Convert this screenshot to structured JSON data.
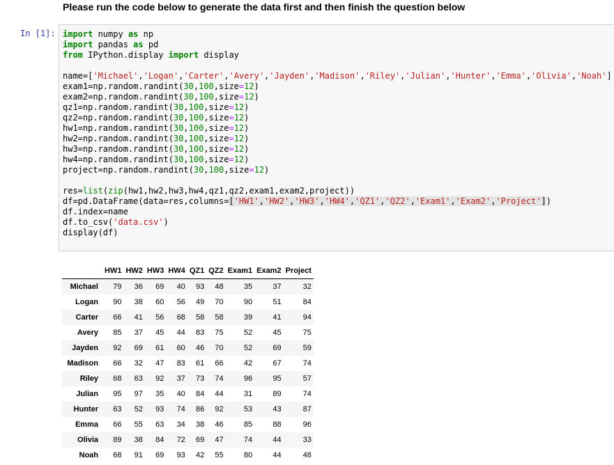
{
  "heading": "Please run the code below to generate the data first and then finish the question below",
  "prompt": "In [1]:",
  "code": {
    "l1_kw": "import",
    "l1_mod": " numpy ",
    "l1_as": "as",
    "l1_alias": " np",
    "l2_kw": "import",
    "l2_mod": " pandas ",
    "l2_as": "as",
    "l2_alias": " pd",
    "l3_from": "from",
    "l3_mod": " IPython.display ",
    "l3_kw": "import",
    "l3_name": " display",
    "names_prefix": "name=",
    "names": [
      "Michael",
      "Logan",
      "Carter",
      "Avery",
      "Jayden",
      "Madison",
      "Riley",
      "Julian",
      "Hunter",
      "Emma",
      "Olivia",
      "Noah"
    ],
    "assign_lines": [
      "exam1",
      "exam2",
      "qz1",
      "qz2",
      "hw1",
      "hw2",
      "hw3",
      "hw4",
      "project"
    ],
    "rand_call": "np.random.randint(",
    "rand_low": "30",
    "rand_high": "100",
    "rand_size_kw": "size",
    "rand_size": "12",
    "res_prefix": "res=",
    "res_list": "list",
    "res_zip": "zip",
    "res_args": "(hw1,hw2,hw3,hw4,qz1,qz2,exam1,exam2,project))",
    "df_prefix": "df=pd.DataFrame(data=res,columns=",
    "columns": [
      "HW1",
      "HW2",
      "HW3",
      "HW4",
      "QZ1",
      "QZ2",
      "Exam1",
      "Exam2",
      "Project"
    ],
    "index_line": "df.index=name",
    "csv_prefix": "df.to_csv(",
    "csv_file": "'data.csv'",
    "display_line": "display(df)"
  },
  "table": {
    "columns": [
      "HW1",
      "HW2",
      "HW3",
      "HW4",
      "QZ1",
      "QZ2",
      "Exam1",
      "Exam2",
      "Project"
    ],
    "rows": [
      {
        "name": "Michael",
        "values": [
          79,
          36,
          69,
          40,
          93,
          48,
          35,
          37,
          32
        ]
      },
      {
        "name": "Logan",
        "values": [
          90,
          38,
          60,
          56,
          49,
          70,
          90,
          51,
          84
        ]
      },
      {
        "name": "Carter",
        "values": [
          66,
          41,
          56,
          68,
          58,
          58,
          39,
          41,
          94
        ]
      },
      {
        "name": "Avery",
        "values": [
          85,
          37,
          45,
          44,
          83,
          75,
          52,
          45,
          75
        ]
      },
      {
        "name": "Jayden",
        "values": [
          92,
          69,
          61,
          60,
          46,
          70,
          52,
          69,
          59
        ]
      },
      {
        "name": "Madison",
        "values": [
          66,
          32,
          47,
          83,
          61,
          66,
          42,
          67,
          74
        ]
      },
      {
        "name": "Riley",
        "values": [
          68,
          63,
          92,
          37,
          73,
          74,
          96,
          95,
          57
        ]
      },
      {
        "name": "Julian",
        "values": [
          95,
          97,
          35,
          40,
          84,
          44,
          31,
          89,
          74
        ]
      },
      {
        "name": "Hunter",
        "values": [
          63,
          52,
          93,
          74,
          86,
          92,
          53,
          43,
          87
        ]
      },
      {
        "name": "Emma",
        "values": [
          66,
          55,
          63,
          34,
          38,
          46,
          85,
          88,
          96
        ]
      },
      {
        "name": "Olivia",
        "values": [
          89,
          38,
          84,
          72,
          69,
          47,
          74,
          44,
          33
        ]
      },
      {
        "name": "Noah",
        "values": [
          68,
          91,
          69,
          93,
          42,
          55,
          80,
          44,
          48
        ]
      }
    ]
  }
}
